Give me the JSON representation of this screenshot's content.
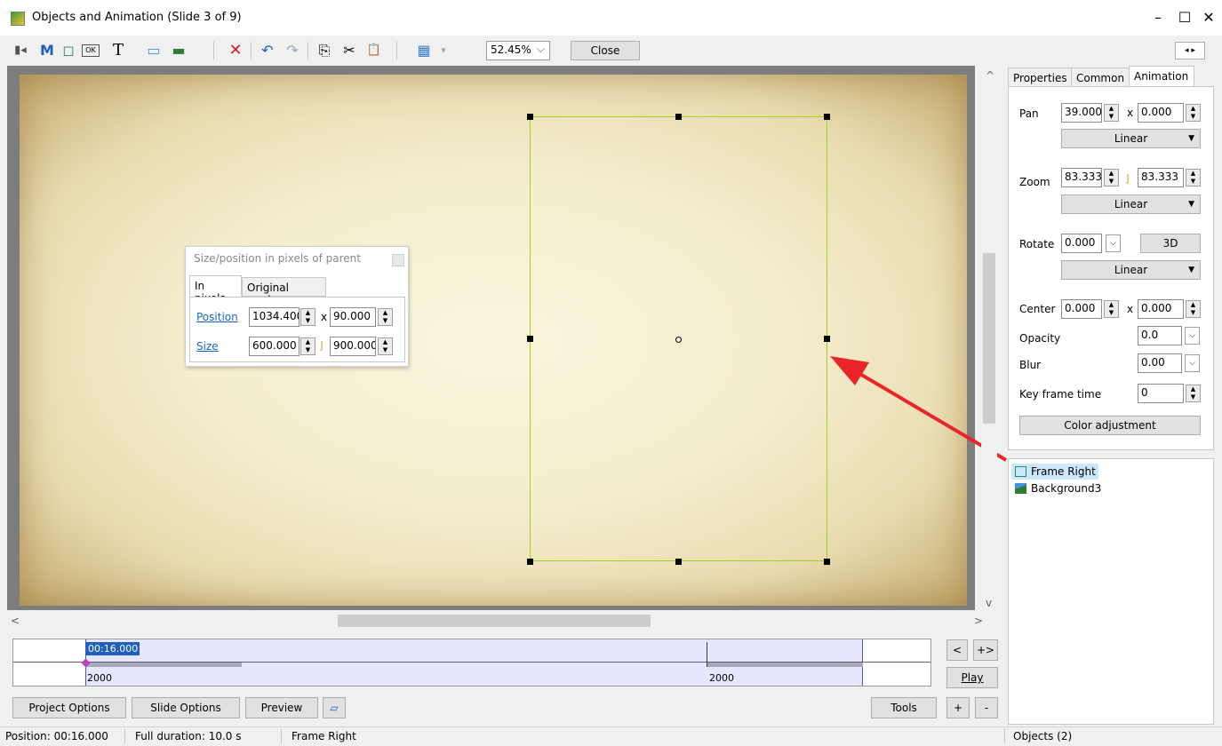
{
  "window": {
    "title": "Objects and Animation  (Slide 3 of 9)",
    "min": "–",
    "max": "☐",
    "close": "✕"
  },
  "toolbar": {
    "zoom": "52.45%",
    "zoom_caret": "⌵",
    "close_label": "Close",
    "panel_arrows": "◂ ▸",
    "icons": {
      "camera": "▮◂",
      "m": "M",
      "frame": "◻",
      "ok": "OK",
      "t": "T",
      "rect": "▭",
      "image": "▬",
      "delete": "✕",
      "undo": "↶",
      "redo": "↷",
      "copy": "⎘",
      "cut": "✂",
      "paste": "📋",
      "grid": "▦",
      "grid_caret": "▾"
    }
  },
  "size_dialog": {
    "title": "Size/position in pixels of parent",
    "tab_pixels": "In pixels",
    "tab_original": "Original mode",
    "position_label": "Position",
    "position_x": "1034.400",
    "position_y": "90.000",
    "size_label": "Size",
    "size_w": "600.000",
    "size_h": "900.000",
    "x_sep": "x",
    "link_sep": "⌋"
  },
  "right_panel": {
    "tabs": [
      "Properties",
      "Common",
      "Animation"
    ],
    "pan_label": "Pan",
    "pan_x": "39.000",
    "pan_y": "0.000",
    "pan_mode": "Linear",
    "zoom_label": "Zoom",
    "zoom_x": "83.333",
    "zoom_y": "83.333",
    "zoom_mode": "Linear",
    "rotate_label": "Rotate",
    "rotate_val": "0.000",
    "btn_3d": "3D",
    "rotate_mode": "Linear",
    "center_label": "Center",
    "center_x": "0.000",
    "center_y": "0.000",
    "opacity_label": "Opacity",
    "opacity_val": "0.0",
    "blur_label": "Blur",
    "blur_val": "0.00",
    "keyframe_label": "Key frame time",
    "keyframe_val": "0",
    "color_adj": "Color adjustment",
    "caret": "▼",
    "small_caret": "⌵",
    "x_sep": "x",
    "link_sep": "⌋"
  },
  "objects": {
    "items": [
      "Frame Right",
      "Background3"
    ]
  },
  "timeline": {
    "current_time": "00:16.000",
    "left_value": "2000",
    "right_value": "2000"
  },
  "controls": {
    "prev": "<",
    "next": "+>",
    "play": "Play",
    "project_options": "Project Options",
    "slide_options": "Slide Options",
    "preview": "Preview",
    "tools": "Tools",
    "plus": "+",
    "minus": "-"
  },
  "status": {
    "position": "Position:  00:16.000",
    "duration": "Full duration:  10.0 s",
    "object": "Frame Right",
    "objects_count": "Objects (2)"
  },
  "scroll": {
    "up": "^",
    "down": "v",
    "left": "<",
    "right": ">"
  }
}
